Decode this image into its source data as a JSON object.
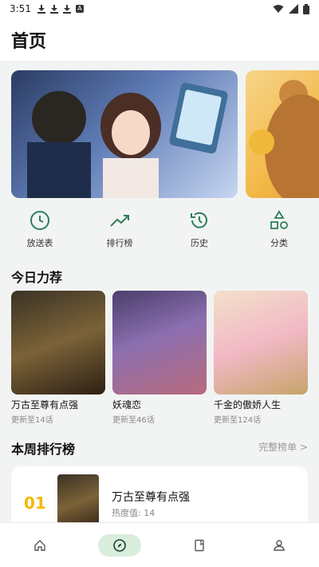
{
  "status": {
    "time": "3:51"
  },
  "header": {
    "title": "首页"
  },
  "quicknav": [
    {
      "label": "放送表",
      "icon": "clock-icon"
    },
    {
      "label": "排行榜",
      "icon": "trending-icon"
    },
    {
      "label": "历史",
      "icon": "history-icon"
    },
    {
      "label": "分类",
      "icon": "shapes-icon"
    }
  ],
  "recommend": {
    "title": "今日力荐",
    "items": [
      {
        "name": "万古至尊有点强",
        "sub": "更新至14话"
      },
      {
        "name": "妖魂恋",
        "sub": "更新至46话"
      },
      {
        "name": "千金的傲娇人生",
        "sub": "更新至124话"
      }
    ]
  },
  "ranking": {
    "title": "本周排行榜",
    "more": "完整榜单 >",
    "items": [
      {
        "rank": "01",
        "name": "万古至尊有点强",
        "heat": "热度值: 14"
      }
    ]
  },
  "colors": {
    "accent": "#2e7d5b",
    "rank_gold": "#f5b800",
    "nav_pill": "#d9eddd"
  },
  "bottomnav": [
    "home-icon",
    "compass-icon",
    "book-icon",
    "profile-icon"
  ]
}
